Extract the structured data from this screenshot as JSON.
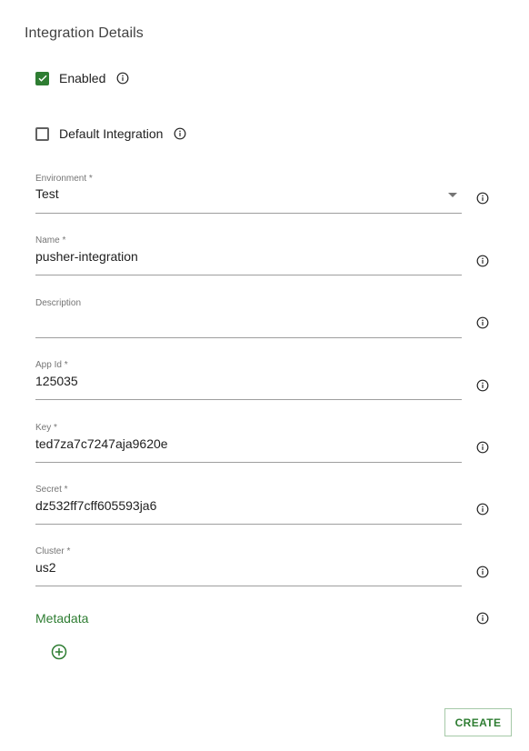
{
  "section": {
    "title": "Integration Details"
  },
  "enabled": {
    "label": "Enabled",
    "checked": true
  },
  "default_integration": {
    "label": "Default Integration",
    "checked": false
  },
  "fields": {
    "environment": {
      "label": "Environment *",
      "value": "Test"
    },
    "name": {
      "label": "Name *",
      "value": "pusher-integration"
    },
    "description": {
      "label": "Description",
      "value": ""
    },
    "app_id": {
      "label": "App Id *",
      "value": "125035"
    },
    "key": {
      "label": "Key *",
      "value": "ted7za7c7247aja9620e"
    },
    "secret": {
      "label": "Secret *",
      "value": "dz532ff7cff605593ja6"
    },
    "cluster": {
      "label": "Cluster *",
      "value": "us2"
    }
  },
  "metadata": {
    "label": "Metadata"
  },
  "actions": {
    "create_label": "CREATE"
  },
  "colors": {
    "accent": "#2e7d32",
    "text": "#212121",
    "muted": "#757575",
    "underline": "#9e9e9e"
  },
  "icons": {
    "info": "info-icon",
    "check": "check-icon",
    "add": "add-circle-icon",
    "dropdown": "chevron-down-icon"
  }
}
